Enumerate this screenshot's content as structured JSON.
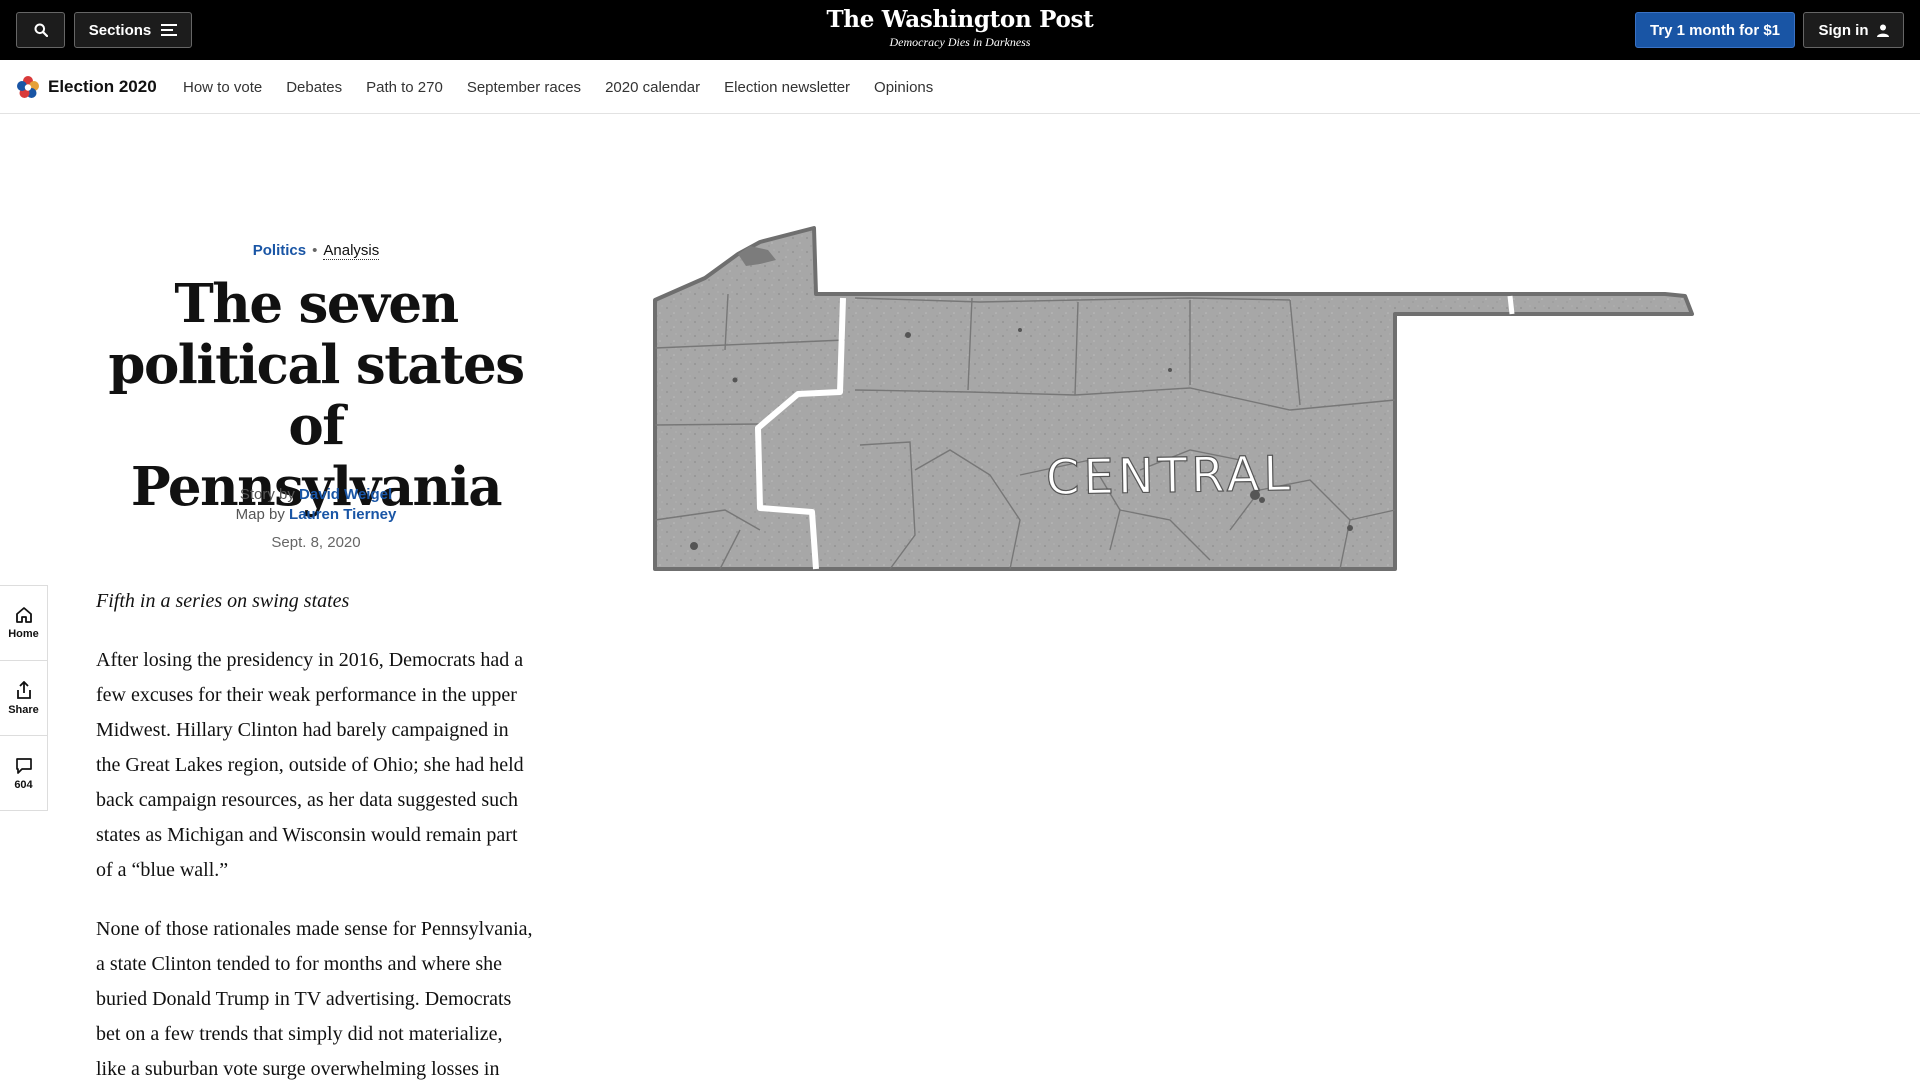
{
  "topbar": {
    "sections_label": "Sections",
    "logo": "The Washington Post",
    "tagline": "Democracy Dies in Darkness",
    "trial_label": "Try 1 month for $1",
    "signin_label": "Sign in"
  },
  "subnav": {
    "brand": "Election 2020",
    "links": [
      "How to vote",
      "Debates",
      "Path to 270",
      "September races",
      "2020 calendar",
      "Election newsletter",
      "Opinions"
    ]
  },
  "rail": {
    "home_label": "Home",
    "share_label": "Share",
    "comments_count": "604"
  },
  "article": {
    "section": "Politics",
    "label": "Analysis",
    "headline_lines": [
      "The seven",
      "political states",
      "of Pennsylvania"
    ],
    "story_by_prefix": "Story by",
    "story_author": "David Weigel",
    "map_by_prefix": "Map by",
    "map_author": "Lauren Tierney",
    "date": "Sept. 8, 2020",
    "series_note": "Fifth in a series on swing states",
    "paragraphs": [
      "After losing the presidency in 2016, Democrats had a few excuses for their weak performance in the upper Midwest. Hillary Clinton had barely campaigned in the Great Lakes region, outside of Ohio; she had held back campaign resources, as her data suggested such states as Michigan and Wisconsin would remain part of a “blue wall.”",
      "None of those rationales made sense for Pennsylvania, a state Clinton tended to for months and where she buried Donald Trump in TV advertising. Democrats bet on a few trends that simply did not materialize, like a suburban vote surge overwhelming losses in"
    ]
  },
  "map": {
    "region_label": "CENTRAL"
  },
  "colors": {
    "accent": "#1955a5",
    "topbar_bg": "#000000",
    "map_fill": "#a9a9a9"
  }
}
